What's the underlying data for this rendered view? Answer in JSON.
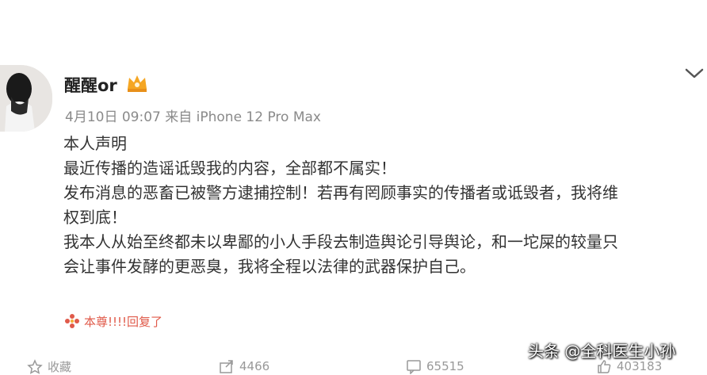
{
  "post": {
    "username": "醒醒or",
    "meta": "4月10日 09:07 来自 iPhone 12 Pro Max",
    "body_lines": [
      "本人声明",
      "最近传播的造谣诋毁我的内容，全部都不属实！",
      "发布消息的恶畜已被警方逮捕控制！若再有罔顾事实的传播者或诋毁者，我将维",
      "权到底！",
      "我本人从始至终都未以卑鄙的小人手段去制造舆论引导舆论，和一坨屎的较量只",
      "会让事件发酵的更恶臭，我将全程以法律的武器保护自己。"
    ],
    "reply_text": "本尊!!!!回复了"
  },
  "actions": {
    "favorite_label": "收藏",
    "share_count": "4466",
    "comment_count": "65515",
    "like_count": "403183"
  },
  "watermark": "头条 @全科医生小孙",
  "icons": {
    "vip": "vip-crown-badge-icon",
    "expand": "chevron-down-icon",
    "reply": "flower-icon",
    "favorite": "star-icon",
    "share": "share-icon",
    "comment": "comment-icon",
    "like": "thumbs-up-icon"
  },
  "colors": {
    "reply_accent": "#e05a4a",
    "badge": "#f5a623"
  }
}
